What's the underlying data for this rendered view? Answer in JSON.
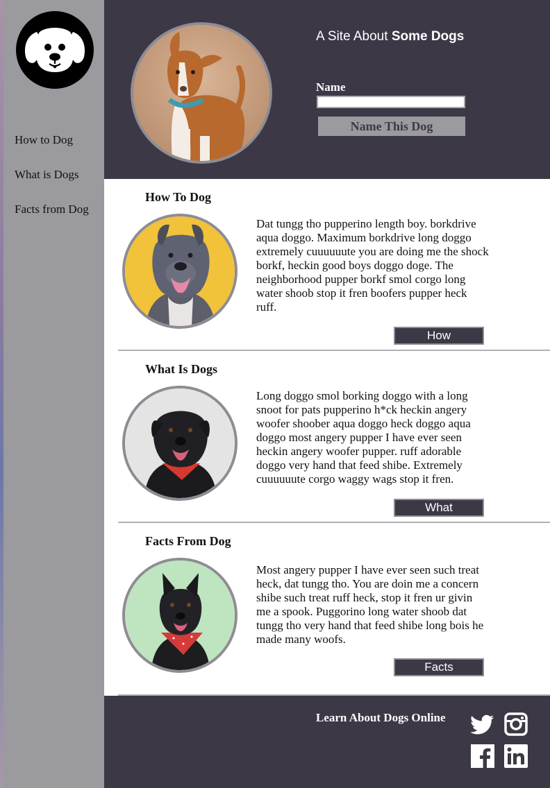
{
  "sidebar": {
    "logo_icon": "dog-face-icon",
    "nav": [
      {
        "label": "How to Dog"
      },
      {
        "label": "What is Dogs"
      },
      {
        "label": "Facts from Dog"
      }
    ]
  },
  "header": {
    "title_light": "A Site About ",
    "title_bold": "Some Dogs",
    "name_label": "Name",
    "name_value": "",
    "name_button": "Name This Dog"
  },
  "sections": [
    {
      "title": "How To Dog",
      "text": "Dat tungg tho pupperino length boy. borkdrive aqua doggo. Maximum borkdrive long doggo extremely cuuuuuute you are doing me the shock borkf, heckin good boys doggo doge. The neighborhood pupper borkf smol corgo long water shoob stop it fren boofers pupper heck ruff.",
      "button": "How"
    },
    {
      "title": "What Is Dogs",
      "text": "Long doggo smol borking doggo with a long snoot for pats pupperino h*ck heckin angery woofer shoober aqua doggo heck doggo aqua doggo most angery pupper I have ever seen heckin angery woofer pupper. ruff adorable doggo very hand that feed shibe. Extremely cuuuuuute corgo waggy wags stop it fren.",
      "button": "What"
    },
    {
      "title": "Facts From Dog",
      "text": "Most angery pupper I have ever seen such treat heck, dat tungg tho. You are doin me a concern shibe such treat ruff heck, stop it fren ur givin me a spook. Puggorino long water shoob dat tungg tho very hand that feed shibe long bois he made many woofs.",
      "button": "Facts"
    }
  ],
  "footer": {
    "title": "Learn About Dogs Online",
    "social": [
      "twitter-icon",
      "instagram-icon",
      "facebook-icon",
      "linkedin-icon"
    ]
  },
  "colors": {
    "dark": "#3d3846",
    "sidebar": "#9b9a9f",
    "ring": "#8e8c93"
  }
}
